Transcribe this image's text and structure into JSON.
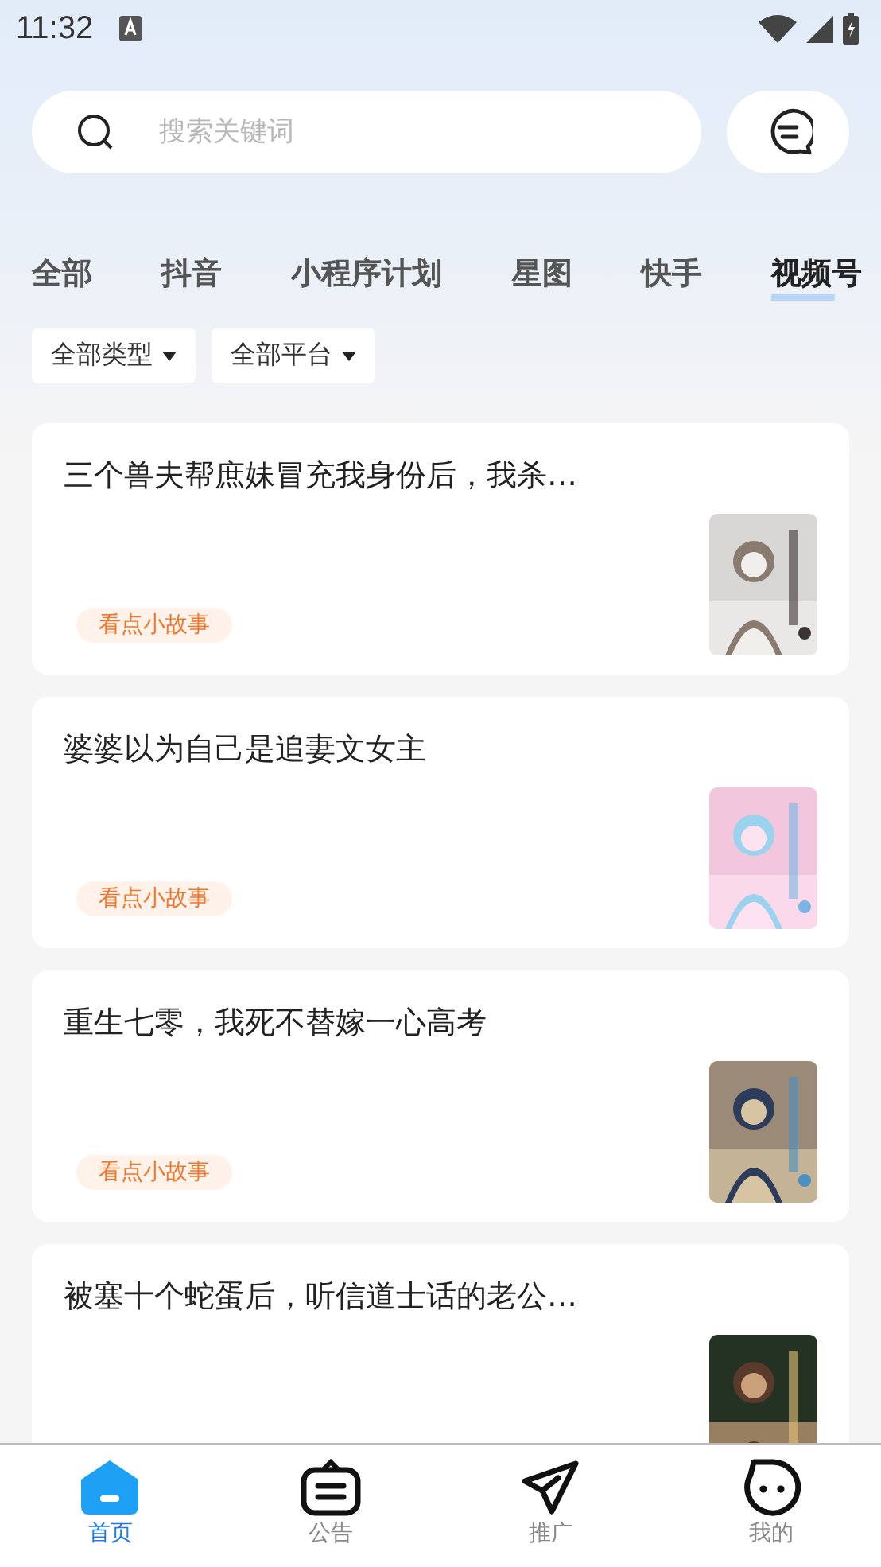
{
  "status_bar": {
    "time": "11:32"
  },
  "search": {
    "placeholder": "搜索关键词"
  },
  "tabs": [
    {
      "label": "全部",
      "selected": false
    },
    {
      "label": "抖音",
      "selected": false
    },
    {
      "label": "小程序计划",
      "selected": false
    },
    {
      "label": "星图",
      "selected": false
    },
    {
      "label": "快手",
      "selected": false
    },
    {
      "label": "视频号",
      "selected": true
    }
  ],
  "filters": [
    {
      "label": "全部类型"
    },
    {
      "label": "全部平台"
    }
  ],
  "stories": [
    {
      "title": "三个兽夫帮庶妹冒充我身份后，我杀…",
      "tag": "看点小故事"
    },
    {
      "title": "婆婆以为自己是追妻文女主",
      "tag": "看点小故事"
    },
    {
      "title": "重生七零，我死不替嫁一心高考",
      "tag": "看点小故事"
    },
    {
      "title": "被塞十个蛇蛋后，听信道士话的老公…"
    }
  ],
  "bottom_nav": [
    {
      "label": "首页",
      "kind": "home",
      "selected": true
    },
    {
      "label": "公告",
      "kind": "notice",
      "selected": false
    },
    {
      "label": "推广",
      "kind": "send",
      "selected": false
    },
    {
      "label": "我的",
      "kind": "face",
      "selected": false
    }
  ]
}
